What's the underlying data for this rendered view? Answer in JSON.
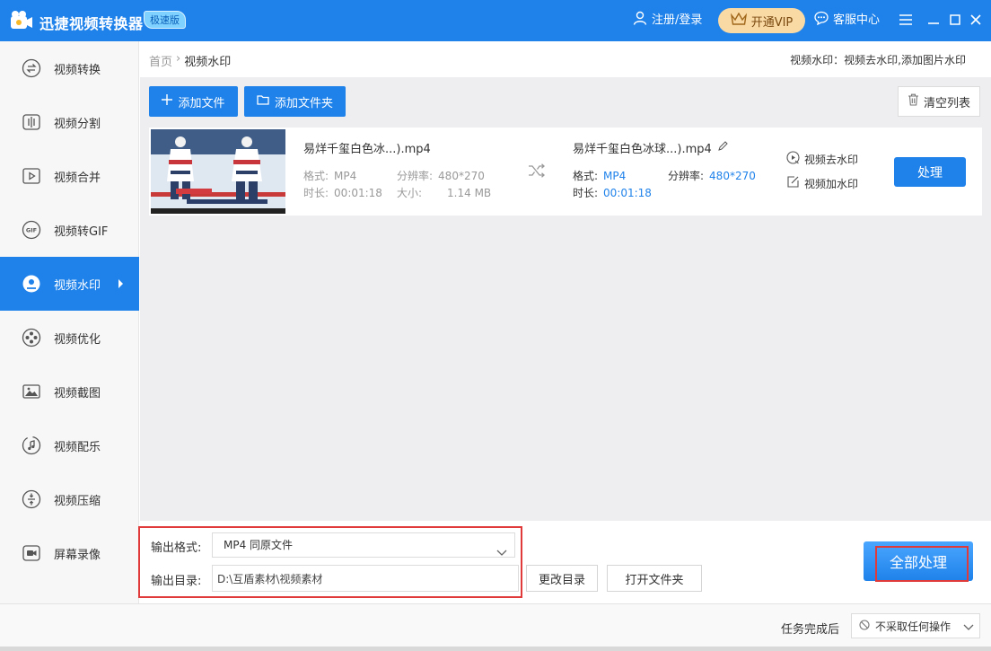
{
  "app": {
    "title": "迅捷视频转换器",
    "edition": "极速版",
    "login_label": "注册/登录",
    "vip_label": "开通VIP",
    "service_label": "客服中心"
  },
  "colors": {
    "accent": "#1f82ea",
    "vip": "#f9d9a4",
    "highlight_box": "#e03a3a"
  },
  "sidebar": {
    "items": [
      {
        "label": "视频转换",
        "icon": "convert-icon"
      },
      {
        "label": "视频分割",
        "icon": "split-icon"
      },
      {
        "label": "视频合并",
        "icon": "merge-icon"
      },
      {
        "label": "视频转GIF",
        "icon": "gif-icon"
      },
      {
        "label": "视频水印",
        "icon": "watermark-icon",
        "active": true
      },
      {
        "label": "视频优化",
        "icon": "optimize-icon"
      },
      {
        "label": "视频截图",
        "icon": "screenshot-icon"
      },
      {
        "label": "视频配乐",
        "icon": "music-icon"
      },
      {
        "label": "视频压缩",
        "icon": "compress-icon"
      },
      {
        "label": "屏幕录像",
        "icon": "record-icon"
      }
    ]
  },
  "breadcrumb": {
    "home": "首页",
    "sep": "›",
    "current": "视频水印"
  },
  "feature_desc": "视频水印：视频去水印,添加图片水印",
  "toolbar": {
    "add_file": "添加文件",
    "add_folder": "添加文件夹",
    "clear_list": "清空列表"
  },
  "file": {
    "src_name": "易烊千玺白色冰...).mp4",
    "format_label": "格式:",
    "format": "MP4",
    "resolution_label": "分辨率:",
    "resolution": "480*270",
    "duration_label": "时长:",
    "duration": "00:01:18",
    "size_label": "大小:",
    "size": "1.14 MB",
    "dst_name": "易烊千玺白色冰球...).mp4",
    "dst_format": "MP4",
    "dst_resolution": "480*270",
    "dst_duration": "00:01:18",
    "remove_watermark": "视频去水印",
    "add_watermark": "视频加水印",
    "process_label": "处理"
  },
  "output": {
    "format_label": "输出格式:",
    "format_value": "MP4  同原文件",
    "dir_label": "输出目录:",
    "dir_value": "D:\\互盾素材\\视频素材",
    "change_dir": "更改目录",
    "open_folder": "打开文件夹",
    "process_all": "全部处理"
  },
  "status": {
    "after_label": "任务完成后",
    "after_value": "不采取任何操作"
  }
}
